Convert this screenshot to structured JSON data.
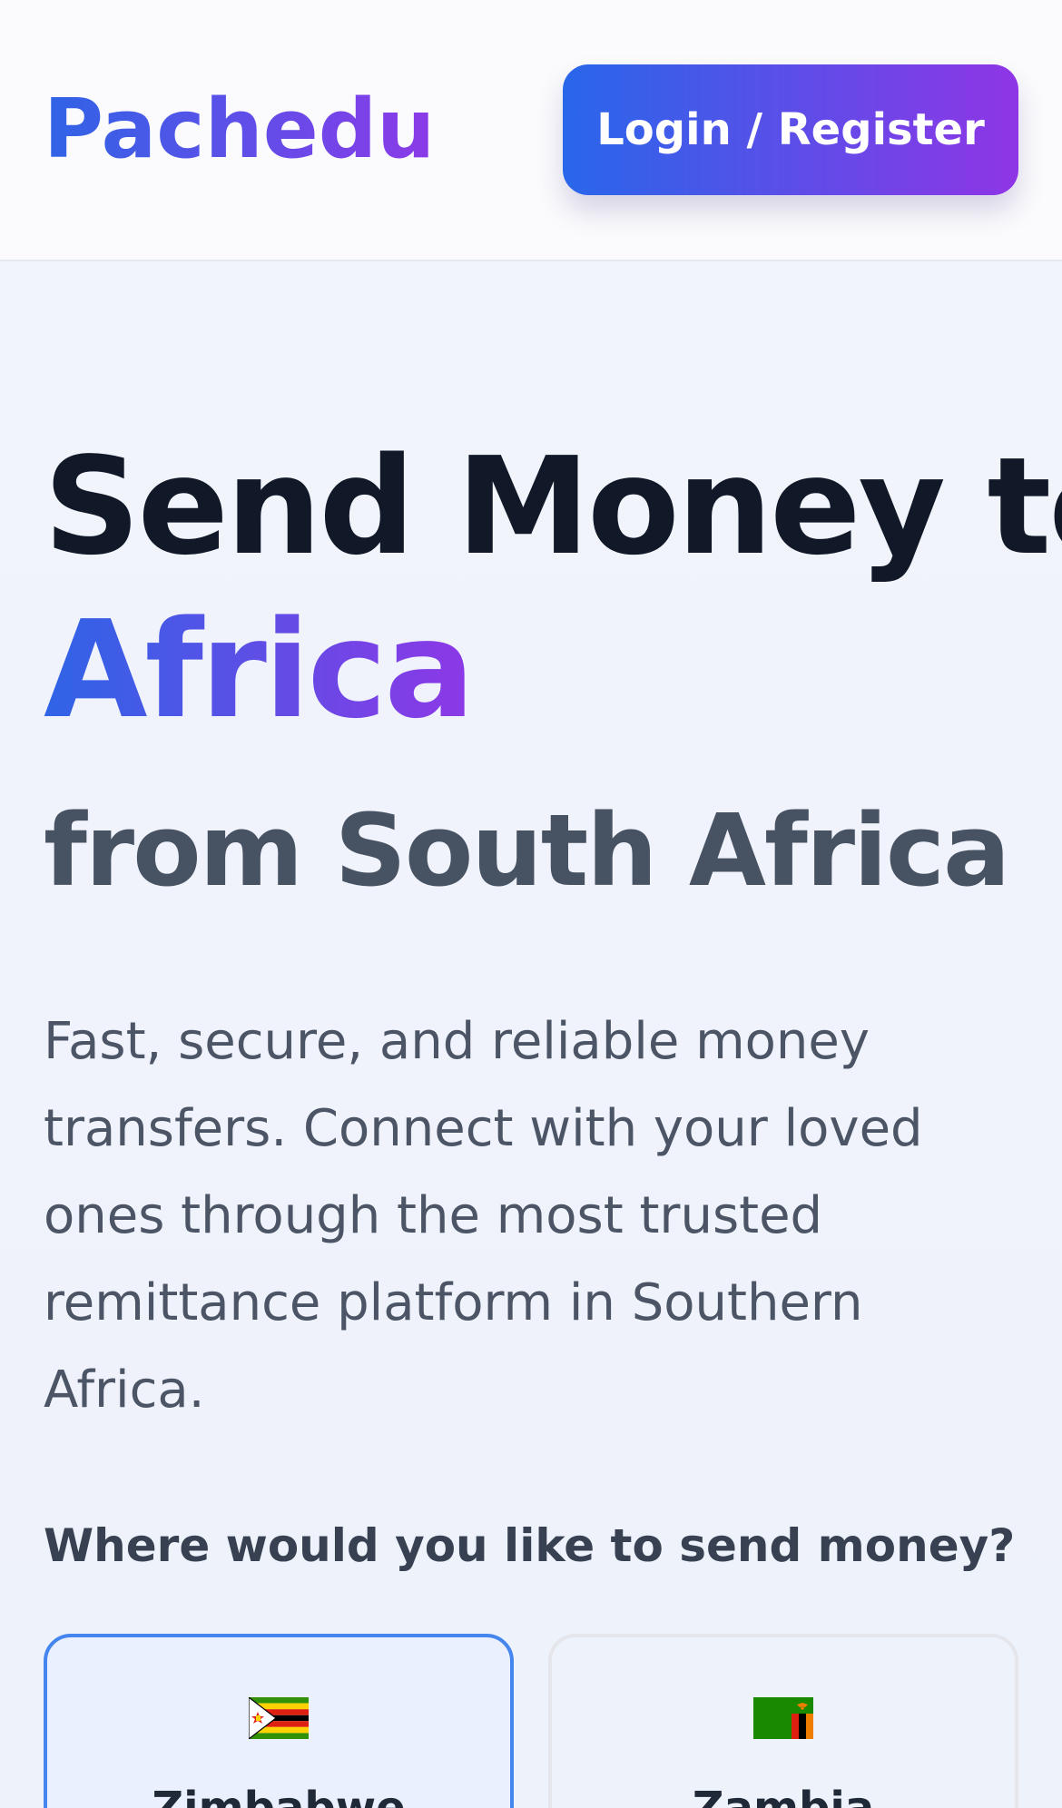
{
  "header": {
    "logo": "Pachedu",
    "login_label": "Login / Register"
  },
  "hero": {
    "line1": "Send Money to",
    "line2": "Africa",
    "line3": "from South Africa",
    "description": "Fast, secure, and reliable money transfers. Connect with your loved ones through the most trusted remittance platform in Southern Africa.",
    "prompt": "Where would you like to send money?"
  },
  "countries": [
    {
      "name": "Zimbabwe",
      "icon": "zimbabwe-flag-icon",
      "selected": true
    },
    {
      "name": "Zambia",
      "icon": "zambia-flag-icon",
      "selected": false
    }
  ],
  "colors": {
    "brand_blue": "#2f64e7",
    "brand_purple": "#8c3ae8",
    "selected_border": "#4486ee"
  }
}
